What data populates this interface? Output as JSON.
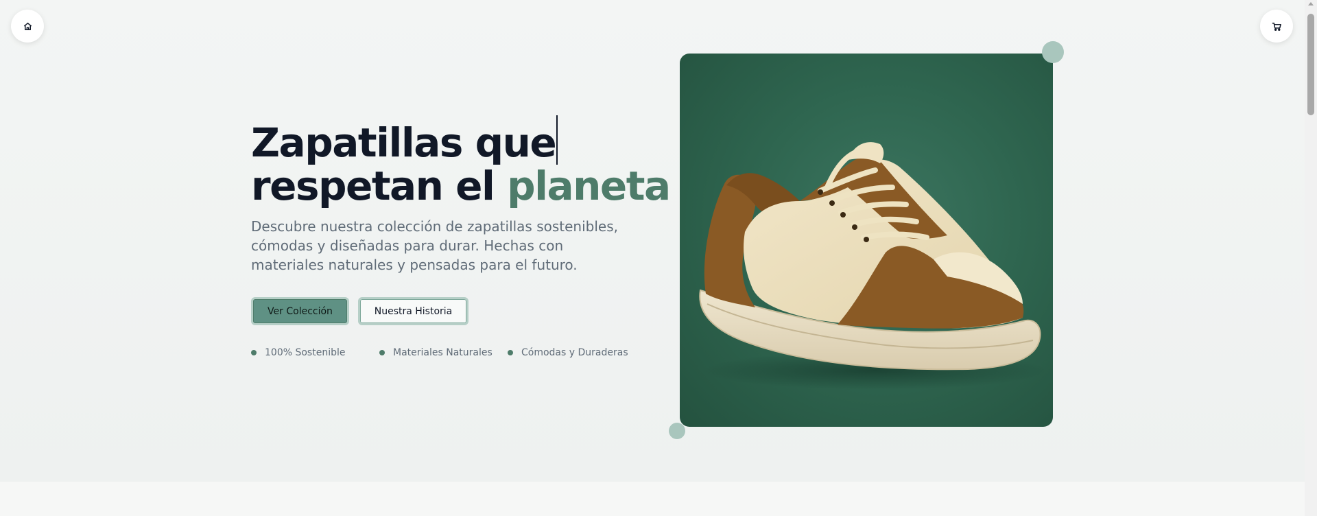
{
  "nav": {
    "home_icon": "home-icon",
    "cart_icon": "cart-icon"
  },
  "hero": {
    "headline_line1": "Zapatillas que",
    "headline_line2_prefix": "respetan el ",
    "headline_accent": "planeta",
    "description": "Descubre nuestra colección de zapatillas sostenibles, cómodas y diseñadas para durar. Hechas con materiales naturales y pensadas para el futuro.",
    "primary_button": "Ver Colección",
    "secondary_button": "Nuestra Historia",
    "features": [
      {
        "label": "100% Sostenible"
      },
      {
        "label": "Materiales Naturales"
      },
      {
        "label": "Cómodas y Duraderas"
      }
    ]
  },
  "colors": {
    "accent": "#4e7c6a",
    "primary_button_bg": "#5f9184",
    "image_bg": "#2f6650",
    "text_dark": "#111827",
    "text_muted": "#5f6b77"
  },
  "image": {
    "subject": "sneaker-product-photo"
  }
}
